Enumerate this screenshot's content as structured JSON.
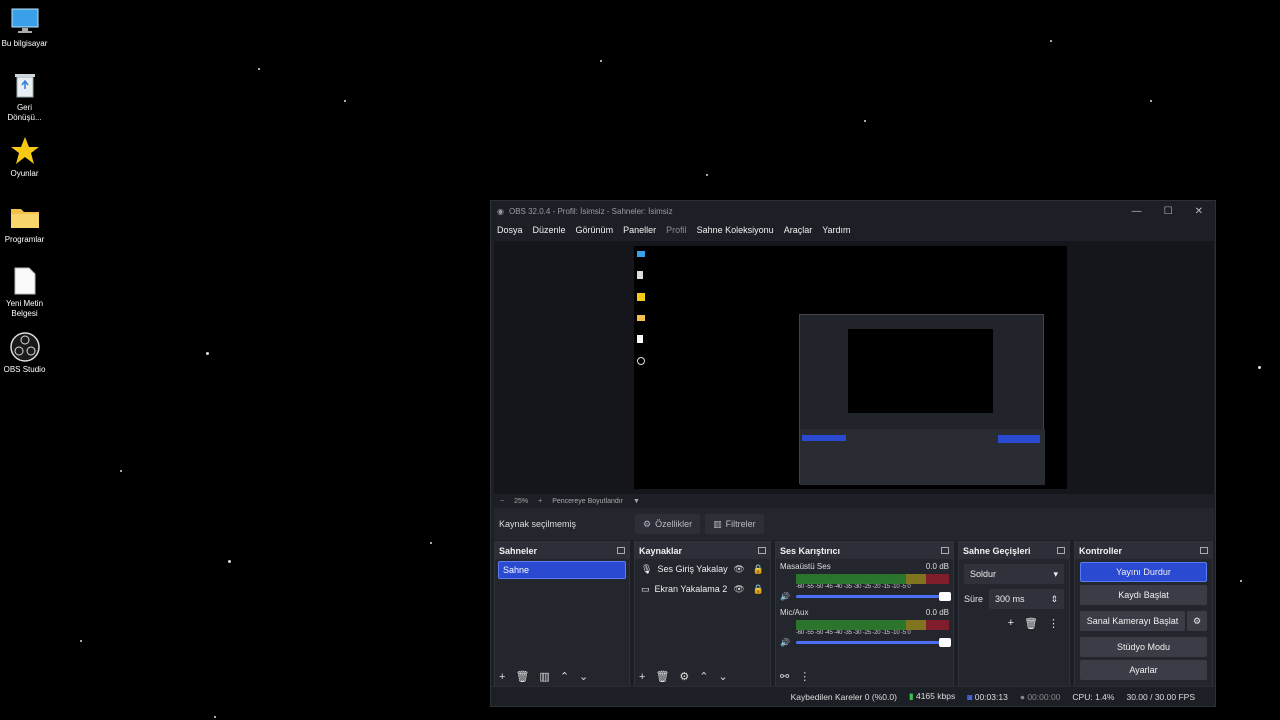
{
  "desktop_icons": [
    {
      "label": "Bu bilgisayar",
      "icon": "monitor-icon"
    },
    {
      "label": "Geri Dönüşü...",
      "icon": "recycle-bin-icon"
    },
    {
      "label": "Oyunlar",
      "icon": "star-icon"
    },
    {
      "label": "Programlar",
      "icon": "folder-icon"
    },
    {
      "label": "Yeni Metin Belgesi",
      "icon": "text-file-icon"
    },
    {
      "label": "OBS Studio",
      "icon": "obs-icon"
    }
  ],
  "window": {
    "title": "OBS 32.0.4 - Profil: İsimsiz - Sahneler: İsimsiz",
    "menu": [
      "Dosya",
      "Düzenle",
      "Görünüm",
      "Paneller",
      "Profil",
      "Sahne Koleksiyonu",
      "Araçlar",
      "Yardım"
    ]
  },
  "zoom": {
    "value": "25%",
    "mode": "Pencereye Boyutlandır"
  },
  "source_bar": {
    "no_selection": "Kaynak seçilmemiş",
    "properties": "Özellikler",
    "filters": "Filtreler"
  },
  "scenes": {
    "title": "Sahneler",
    "items": [
      "Sahne"
    ]
  },
  "sources": {
    "title": "Kaynaklar",
    "items": [
      "Ses Giriş Yakalayıcısı",
      "Ekran Yakalama 2"
    ]
  },
  "mixer": {
    "title": "Ses Karıştırıcı",
    "channels": [
      {
        "name": "Masaüstü Ses",
        "level": "0.0 dB"
      },
      {
        "name": "Mic/Aux",
        "level": "0.0 dB"
      }
    ],
    "scale": "-60 -55 -50 -45 -40 -35 -30 -25 -20 -15 -10 -5 0"
  },
  "transitions": {
    "title": "Sahne Geçişleri",
    "selected": "Soldur",
    "duration_label": "Süre",
    "duration": "300 ms"
  },
  "controls": {
    "title": "Kontroller",
    "buttons": [
      "Yayını Durdur",
      "Kaydı Başlat",
      "Sanal Kamerayı Başlat",
      "Stüdyo Modu",
      "Ayarlar"
    ]
  },
  "status": {
    "dropped": "Kaybedilen Kareler 0 (%0.0)",
    "bitrate": "4165 kbps",
    "stream_time": "00:03:13",
    "rec_time": "00:00:00",
    "cpu": "CPU: 1.4%",
    "fps": "30.00 / 30.00 FPS"
  },
  "colors": {
    "accent": "#2a4ad2",
    "bg": "#1d1f26",
    "panel": "#24262e"
  }
}
